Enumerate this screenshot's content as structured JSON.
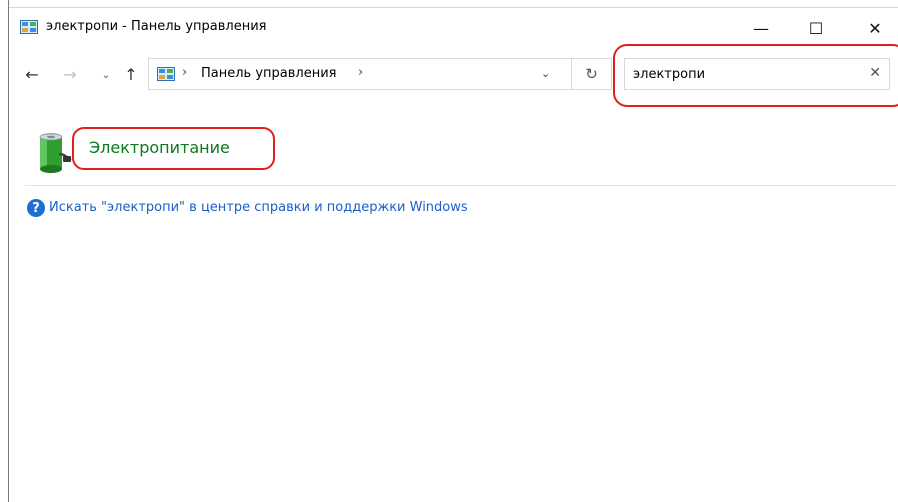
{
  "window": {
    "title": "электропи - Панель управления",
    "controls": {
      "minimize": "—",
      "maximize": "☐",
      "close": "✕"
    }
  },
  "navigation": {
    "back": "←",
    "forward": "→",
    "recent": "⌄",
    "up": "↑",
    "address_separator": "›",
    "address_location": "Панель управления",
    "address_dropdown": "⌄",
    "refresh": "↻"
  },
  "search": {
    "value": "электропи",
    "clear": "✕"
  },
  "results": [
    {
      "label": "Электропитание",
      "icon": "battery-power-icon"
    }
  ],
  "help": {
    "icon": "?",
    "link_text": "Искать \"электропи\" в центре справки и поддержки Windows"
  },
  "colors": {
    "result_link": "#0a7a1e",
    "help_link": "#1a5fc8",
    "highlight": "#e0201a"
  }
}
